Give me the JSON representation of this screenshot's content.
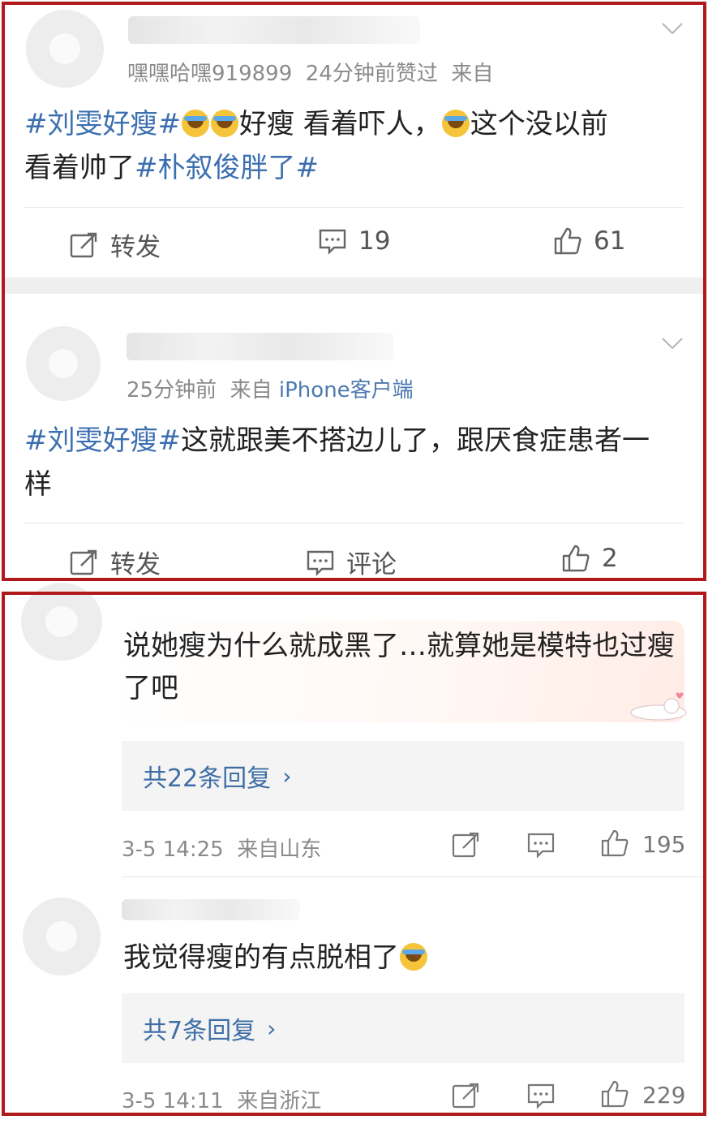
{
  "post1": {
    "meta_user": "嘿嘿哈嘿919899",
    "meta_time": "24分钟前赞过",
    "meta_from": "来自",
    "text_tag1": "#刘雯好瘦#",
    "text_mid": "好瘦 看着吓人，",
    "text_mid2": "这个没以前",
    "text_line2": "看着帅了",
    "text_tag2": "#朴叙俊胖了#",
    "repost_label": "转发",
    "comment_count": "19",
    "like_count": "61"
  },
  "post2": {
    "meta_time": "25分钟前",
    "meta_from": "来自",
    "meta_source": "iPhone客户端",
    "text_tag": "#刘雯好瘦#",
    "text_rest": "这就跟美不搭边儿了，跟厌食症患者一样",
    "repost_label": "转发",
    "comment_label": "评论",
    "like_count": "2"
  },
  "comment1": {
    "text": "说她瘦为什么就成黑了…就算她是模特也过瘦了吧",
    "replies": "共22条回复",
    "time": "3-5 14:25",
    "location": "来自山东",
    "like_count": "195"
  },
  "comment2": {
    "text": "我觉得瘦的有点脱相了",
    "replies": "共7条回复",
    "time": "3-5 14:11",
    "location": "来自浙江",
    "like_count": "229"
  },
  "colors": {
    "frame": "#b0191b",
    "link": "#3b6fb0"
  },
  "icons": [
    "repost-icon",
    "comment-icon",
    "like-icon",
    "chevron-down-icon",
    "share-icon",
    "emoji-laugh-cry",
    "emoji-crying"
  ]
}
